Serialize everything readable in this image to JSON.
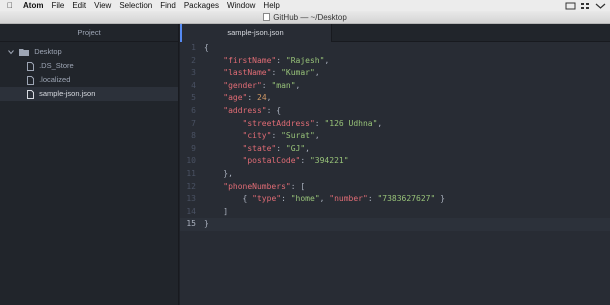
{
  "menubar": {
    "app_name": "Atom",
    "items": [
      "File",
      "Edit",
      "View",
      "Selection",
      "Find",
      "Packages",
      "Window",
      "Help"
    ]
  },
  "window": {
    "title": "GitHub — ~/Desktop"
  },
  "sidebar": {
    "header": "Project",
    "root": "Desktop",
    "files": [
      ".DS_Store",
      ".localized",
      "sample-json.json"
    ]
  },
  "editor": {
    "tab_label": "sample-json.json",
    "line_numbers": [
      "1",
      "2",
      "3",
      "4",
      "5",
      "6",
      "7",
      "8",
      "9",
      "10",
      "11",
      "12",
      "13",
      "14",
      "15"
    ],
    "lines": [
      "{",
      "    \"firstName\": \"Rajesh\",",
      "    \"lastName\": \"Kumar\",",
      "    \"gender\": \"man\",",
      "    \"age\": 24,",
      "    \"address\": {",
      "        \"streetAddress\": \"126 Udhna\",",
      "        \"city\": \"Surat\",",
      "        \"state\": \"GJ\",",
      "        \"postalCode\": \"394221\"",
      "    },",
      "    \"phoneNumbers\": [",
      "        { \"type\": \"home\", \"number\": \"7383627627\" }",
      "    ]",
      "}"
    ]
  },
  "colors": {
    "key": "#e06c75",
    "string": "#98c379",
    "number": "#d19a66",
    "punct": "#abb2bf",
    "accent": "#568af2"
  }
}
